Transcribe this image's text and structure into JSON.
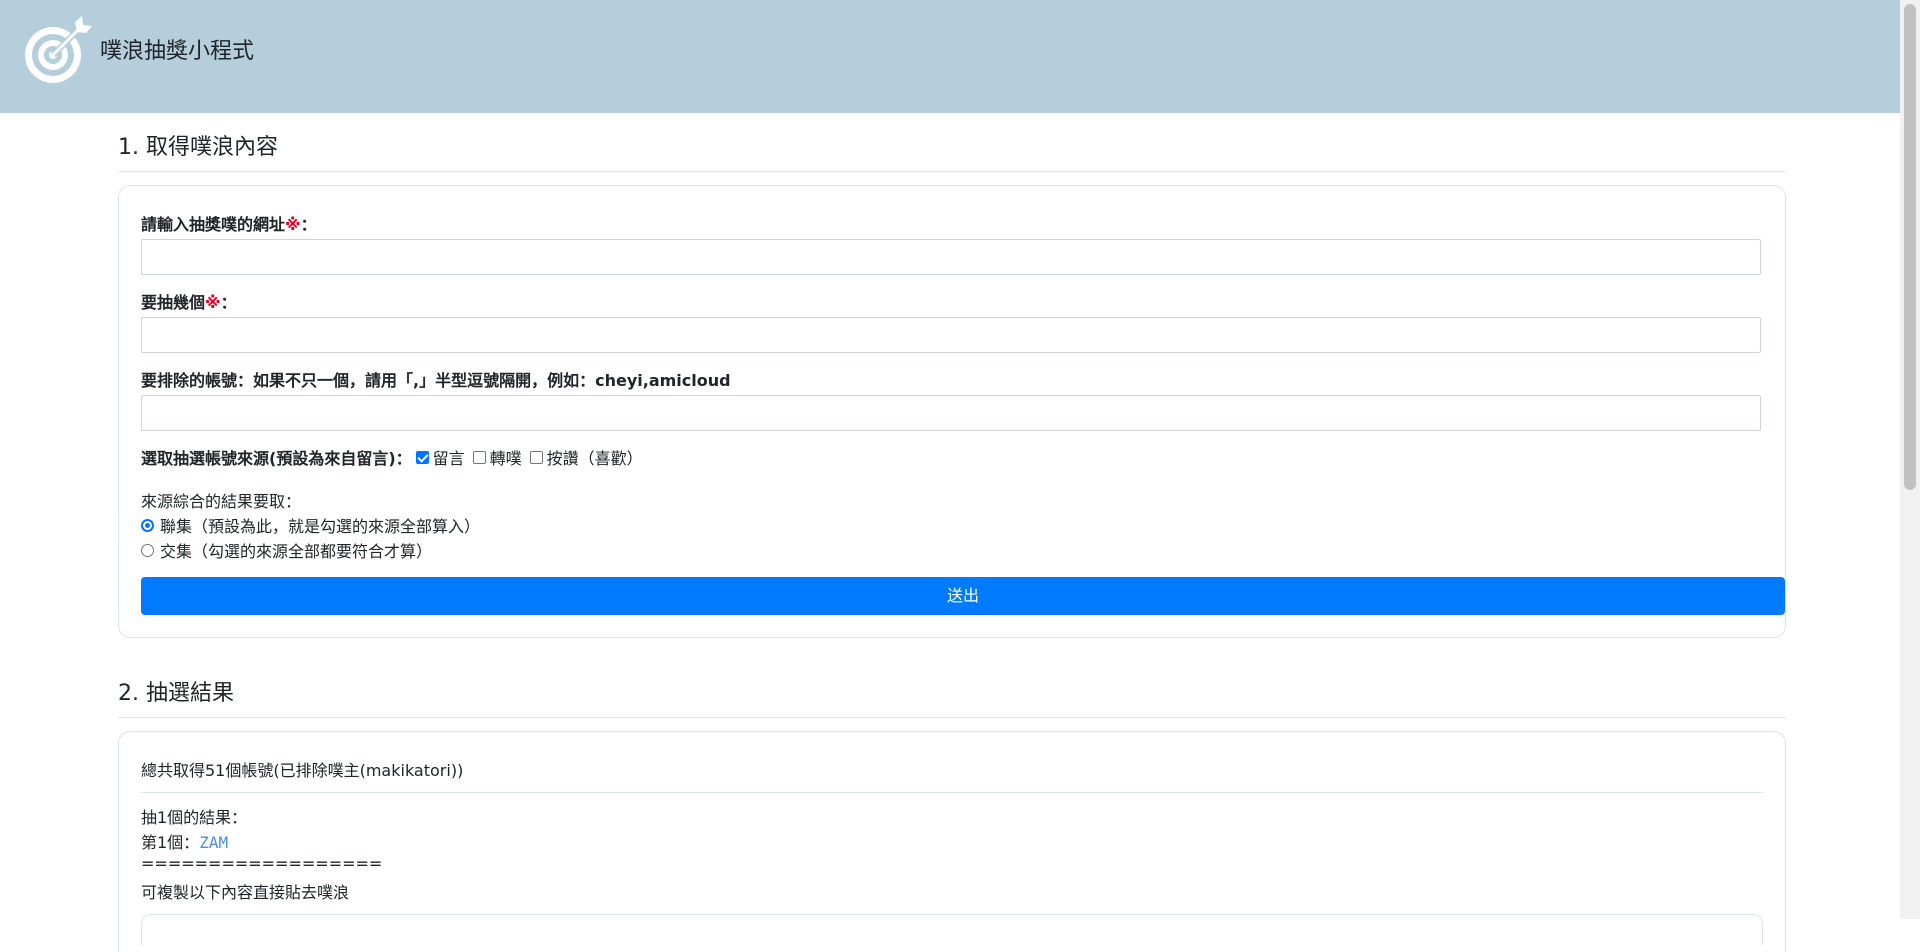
{
  "header": {
    "title": "噗浪抽獎小程式",
    "background": "#b5cedc"
  },
  "section1": {
    "title": "1. 取得噗浪內容",
    "url_label": "請輸入抽獎噗的網址",
    "url_required": "※",
    "url_colon": "：",
    "url_value": "",
    "count_label": "要抽幾個",
    "count_required": "※",
    "count_colon": "：",
    "count_value": "",
    "exclude_label_prefix": "要排除的帳號：如果不只一個，請用「,」半型逗號隔開，例如：",
    "exclude_label_example": "cheyi,amicloud",
    "exclude_value": "",
    "source_label": "選取抽選帳號來源(預設為來自留言)：",
    "source_options": [
      {
        "label": "留言",
        "checked": true
      },
      {
        "label": "轉噗",
        "checked": false
      },
      {
        "label": "按讚（喜歡）",
        "checked": false
      }
    ],
    "combine_label": "來源綜合的結果要取：",
    "combine_options": [
      {
        "label": "聯集（預設為此，就是勾選的來源全部算入）",
        "selected": true
      },
      {
        "label": "交集（勾選的來源全部都要符合才算）",
        "selected": false
      }
    ],
    "submit_label": "送出",
    "accent_color": "#007bff"
  },
  "section2": {
    "title": "2. 抽選結果",
    "summary": "總共取得51個帳號(已排除噗主(makikatori))",
    "result_heading": "抽1個的結果：",
    "winner_prefix": "第1個：",
    "winner_name": "ZAM",
    "separator": "==================",
    "copy_hint": "可複製以下內容直接貼去噗浪"
  }
}
